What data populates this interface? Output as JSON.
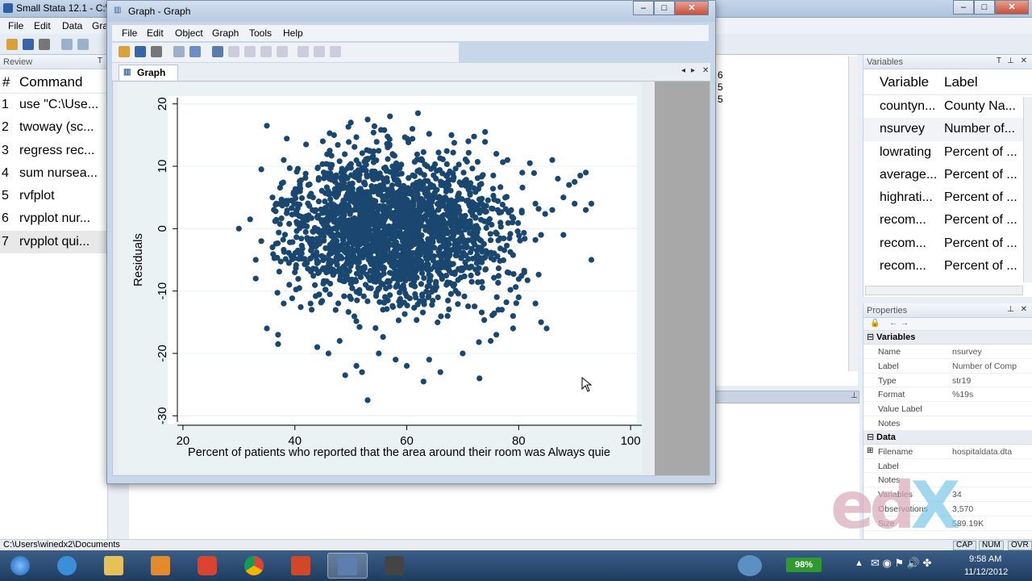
{
  "main_window": {
    "title": "Small Stata 12.1 - C:\\U",
    "menu": [
      "File",
      "Edit",
      "Data",
      "Gra"
    ],
    "cmd_bar_icon": "pin-icon"
  },
  "review": {
    "pane_title": "Review",
    "col_num": "#",
    "col_command": "Command",
    "items": [
      {
        "n": "1",
        "cmd": "use \"C:\\Use..."
      },
      {
        "n": "2",
        "cmd": "twoway (sc..."
      },
      {
        "n": "3",
        "cmd": "regress rec..."
      },
      {
        "n": "4",
        "cmd": "sum nursea..."
      },
      {
        "n": "5",
        "cmd": "rvfplot"
      },
      {
        "n": "6",
        "cmd": "rvpplot nur..."
      },
      {
        "n": "7",
        "cmd": "rvpplot qui..."
      }
    ]
  },
  "results": {
    "partial_digits": [
      "6",
      "5",
      "5"
    ]
  },
  "variables": {
    "pane_title": "Variables",
    "col_variable": "Variable",
    "col_label": "Label",
    "rows": [
      {
        "name": "countyn...",
        "label": "County Na..."
      },
      {
        "name": "nsurvey",
        "label": "Number of..."
      },
      {
        "name": "lowrating",
        "label": "Percent of ..."
      },
      {
        "name": "average...",
        "label": "Percent of ..."
      },
      {
        "name": "highrati...",
        "label": "Percent of ..."
      },
      {
        "name": "recom...",
        "label": "Percent of ..."
      },
      {
        "name": "recom...",
        "label": "Percent of ..."
      },
      {
        "name": "recom...",
        "label": "Percent of ..."
      }
    ]
  },
  "properties": {
    "pane_title": "Properties",
    "sec_variables": "Variables",
    "var_rows": [
      {
        "k": "Name",
        "v": "nsurvey"
      },
      {
        "k": "Label",
        "v": "Number of Comp"
      },
      {
        "k": "Type",
        "v": "str19"
      },
      {
        "k": "Format",
        "v": "%19s"
      },
      {
        "k": "Value Label",
        "v": ""
      },
      {
        "k": "Notes",
        "v": ""
      }
    ],
    "sec_data": "Data",
    "data_rows": [
      {
        "k": "Filename",
        "v": "hospitaldata.dta"
      },
      {
        "k": "Label",
        "v": ""
      },
      {
        "k": "Notes",
        "v": ""
      },
      {
        "k": "Variables",
        "v": "34"
      },
      {
        "k": "Observations",
        "v": "3,570"
      },
      {
        "k": "Size",
        "v": "589.19K"
      }
    ]
  },
  "status": {
    "path": "C:\\Users\\winedx2\\Documents",
    "caps": "CAP",
    "num": "NUM",
    "ovr": "OVR"
  },
  "taskbar": {
    "battery": "98%",
    "time": "9:58 AM",
    "date": "11/12/2012"
  },
  "graph_window": {
    "title": "Graph - Graph",
    "menu": [
      "File",
      "Edit",
      "Object",
      "Graph",
      "Tools",
      "Help"
    ],
    "tab": "Graph"
  },
  "chart_data": {
    "type": "scatter",
    "title": "",
    "xlabel": "Percent of patients who reported that the area around their room was Always quie",
    "ylabel": "Residuals",
    "xlim": [
      19,
      102
    ],
    "ylim": [
      -31,
      21
    ],
    "xticks": [
      20,
      40,
      60,
      80,
      100
    ],
    "yticks": [
      -30,
      -20,
      -10,
      0,
      10,
      20
    ],
    "grid": "horizontal",
    "marker_color": "#1a476f",
    "n_points": 3570,
    "x_mean": 58,
    "x_sd": 10,
    "y_mean": 0,
    "y_sd": 7,
    "points": [
      [
        30,
        0
      ],
      [
        32,
        1.5
      ],
      [
        33,
        -5
      ],
      [
        33,
        -8
      ],
      [
        34,
        9.5
      ],
      [
        34,
        -2
      ],
      [
        35,
        -16
      ],
      [
        35,
        16.5
      ],
      [
        36,
        5
      ],
      [
        36,
        -3
      ],
      [
        37,
        -17
      ],
      [
        37,
        -18.5
      ],
      [
        38,
        11
      ],
      [
        38,
        -12
      ],
      [
        39,
        -9
      ],
      [
        40,
        -7
      ],
      [
        42,
        13.5
      ],
      [
        43,
        -13
      ],
      [
        44,
        -19
      ],
      [
        45,
        14
      ],
      [
        46,
        -20
      ],
      [
        47,
        15
      ],
      [
        48,
        -18
      ],
      [
        49,
        -23.5
      ],
      [
        50,
        17
      ],
      [
        51,
        -22
      ],
      [
        52,
        -23
      ],
      [
        53,
        -27.5
      ],
      [
        53,
        17.5
      ],
      [
        55,
        -20
      ],
      [
        57,
        18
      ],
      [
        58,
        -21
      ],
      [
        60,
        -22
      ],
      [
        61,
        16
      ],
      [
        62,
        18.5
      ],
      [
        63,
        -24.5
      ],
      [
        64,
        -21
      ],
      [
        66,
        -23
      ],
      [
        68,
        15
      ],
      [
        70,
        -20
      ],
      [
        71,
        14
      ],
      [
        73,
        -24
      ],
      [
        74,
        15.5
      ],
      [
        75,
        -18
      ],
      [
        76,
        12
      ],
      [
        78,
        11
      ],
      [
        79,
        -16
      ],
      [
        80,
        -11
      ],
      [
        82,
        10.5
      ],
      [
        83,
        -12
      ],
      [
        84,
        -15
      ],
      [
        85,
        -16
      ],
      [
        86,
        11
      ],
      [
        87,
        8
      ],
      [
        88,
        5
      ],
      [
        89,
        7
      ],
      [
        90,
        4
      ],
      [
        91,
        8.5
      ],
      [
        92,
        9
      ],
      [
        93,
        4
      ],
      [
        93,
        -5
      ],
      [
        88,
        -1
      ],
      [
        84,
        -1
      ],
      [
        92,
        3
      ],
      [
        90,
        7.5
      ],
      [
        86,
        3
      ],
      [
        83,
        4
      ],
      [
        81,
        -7
      ],
      [
        79,
        -14
      ],
      [
        77,
        -13
      ],
      [
        76,
        -17
      ]
    ]
  }
}
